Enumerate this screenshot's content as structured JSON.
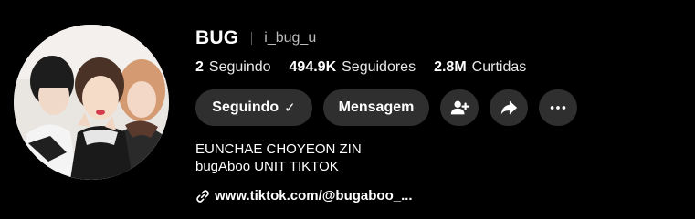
{
  "profile": {
    "display_name": "BUG",
    "username": "i_bug_u"
  },
  "stats": {
    "following_count": "2",
    "following_label": "Seguindo",
    "followers_count": "494.9K",
    "followers_label": "Seguidores",
    "likes_count": "2.8M",
    "likes_label": "Curtidas"
  },
  "actions": {
    "following_button": "Seguindo",
    "following_check": "✓",
    "message_button": "Mensagem",
    "add_friend_icon": "person-plus-icon",
    "share_icon": "share-arrow-icon",
    "more_icon": "more-dots-icon"
  },
  "bio": {
    "line1": "EUNCHAE CHOYEON ZIN",
    "line2": "bugAboo UNIT TIKTOK"
  },
  "link": {
    "icon": "link-icon",
    "text": "www.tiktok.com/@bugaboo_..."
  },
  "colors": {
    "background": "#000000",
    "button": "#2f2f2f",
    "text": "#ffffff",
    "muted": "#bdbdbd"
  }
}
